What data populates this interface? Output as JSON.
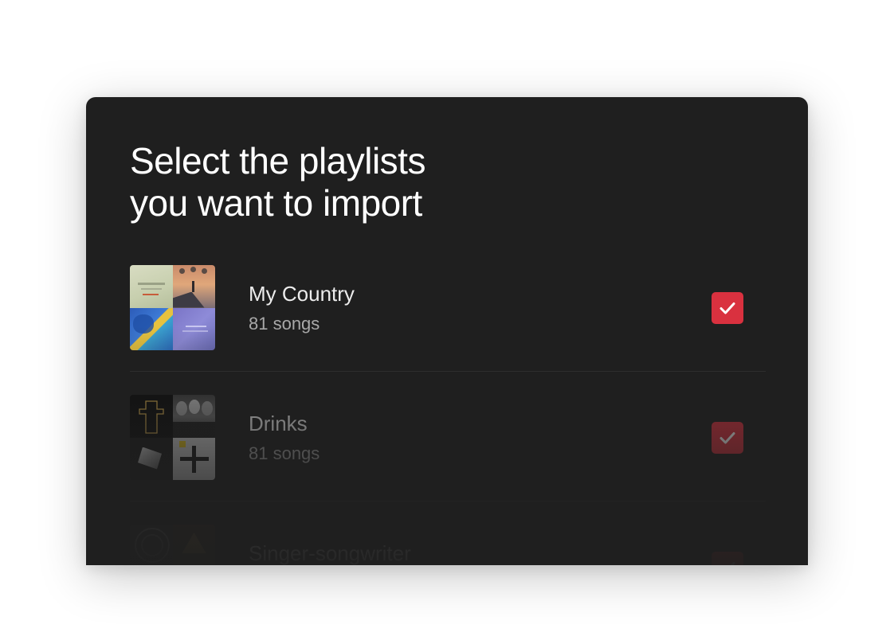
{
  "colors": {
    "panel_bg": "#1f1f1f",
    "check_accent": "#d9313f",
    "title_text": "#ffffff",
    "secondary_text": "#a9a9a9"
  },
  "header": {
    "title_line1": "Select the playlists",
    "title_line2": "you want to import"
  },
  "playlists": [
    {
      "name": "My Country",
      "count": "81 songs",
      "checked": true,
      "icon": "checkmark-icon"
    },
    {
      "name": "Drinks",
      "count": "81 songs",
      "checked": true,
      "icon": "checkmark-icon"
    },
    {
      "name": "Singer-songwriter",
      "count": "",
      "checked": true,
      "icon": "checkmark-icon"
    }
  ]
}
